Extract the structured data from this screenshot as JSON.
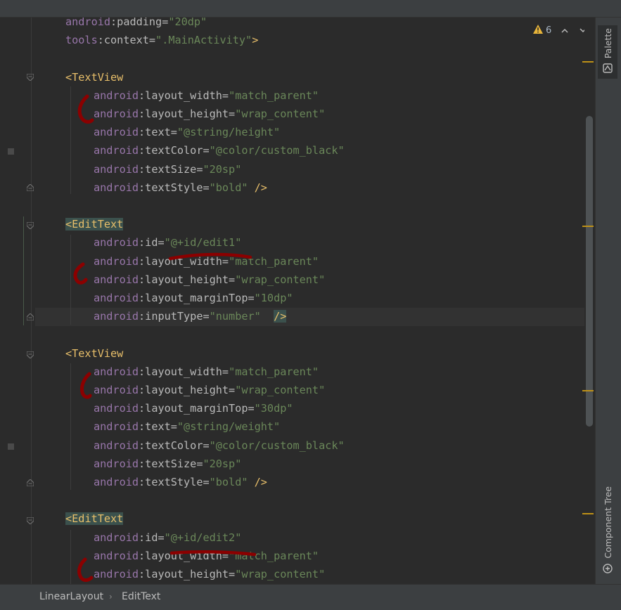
{
  "editor": {
    "lines": [
      {
        "indent": 0,
        "type": "attr",
        "ns": "android",
        "name": "padding",
        "value": "\"20dp\""
      },
      {
        "indent": 0,
        "type": "attr_close",
        "ns": "tools",
        "name": "context",
        "value": "\".MainActivity\"",
        "close": ">"
      },
      {
        "indent": 0,
        "type": "blank"
      },
      {
        "indent": 0,
        "type": "tag",
        "text": "<TextView"
      },
      {
        "indent": 1,
        "type": "attr",
        "ns": "android",
        "name": "layout_width",
        "value": "\"match_parent\""
      },
      {
        "indent": 1,
        "type": "attr",
        "ns": "android",
        "name": "layout_height",
        "value": "\"wrap_content\""
      },
      {
        "indent": 1,
        "type": "attr",
        "ns": "android",
        "name": "text",
        "value": "\"@string/height\""
      },
      {
        "indent": 1,
        "type": "attr",
        "ns": "android",
        "name": "textColor",
        "value": "\"@color/custom_black\""
      },
      {
        "indent": 1,
        "type": "attr",
        "ns": "android",
        "name": "textSize",
        "value": "\"20sp\""
      },
      {
        "indent": 1,
        "type": "attr_close",
        "ns": "android",
        "name": "textStyle",
        "value": "\"bold\"",
        "close": " />"
      },
      {
        "indent": 0,
        "type": "blank"
      },
      {
        "indent": 0,
        "type": "tag_hl",
        "lt": "<",
        "text": "EditText"
      },
      {
        "indent": 1,
        "type": "attr",
        "ns": "android",
        "name": "id",
        "value": "\"@+id/edit1\""
      },
      {
        "indent": 1,
        "type": "attr",
        "ns": "android",
        "name": "layout_width",
        "value": "\"match_parent\""
      },
      {
        "indent": 1,
        "type": "attr",
        "ns": "android",
        "name": "layout_height",
        "value": "\"wrap_content\""
      },
      {
        "indent": 1,
        "type": "attr",
        "ns": "android",
        "name": "layout_marginTop",
        "value": "\"10dp\""
      },
      {
        "indent": 1,
        "type": "attr_close_hl",
        "ns": "android",
        "name": "inputType",
        "value": "\"number\"",
        "close": "/>"
      },
      {
        "indent": 0,
        "type": "blank"
      },
      {
        "indent": 0,
        "type": "tag",
        "text": "<TextView"
      },
      {
        "indent": 1,
        "type": "attr",
        "ns": "android",
        "name": "layout_width",
        "value": "\"match_parent\""
      },
      {
        "indent": 1,
        "type": "attr",
        "ns": "android",
        "name": "layout_height",
        "value": "\"wrap_content\""
      },
      {
        "indent": 1,
        "type": "attr",
        "ns": "android",
        "name": "layout_marginTop",
        "value": "\"30dp\""
      },
      {
        "indent": 1,
        "type": "attr",
        "ns": "android",
        "name": "text",
        "value": "\"@string/weight\""
      },
      {
        "indent": 1,
        "type": "attr",
        "ns": "android",
        "name": "textColor",
        "value": "\"@color/custom_black\""
      },
      {
        "indent": 1,
        "type": "attr",
        "ns": "android",
        "name": "textSize",
        "value": "\"20sp\""
      },
      {
        "indent": 1,
        "type": "attr_close",
        "ns": "android",
        "name": "textStyle",
        "value": "\"bold\"",
        "close": " />"
      },
      {
        "indent": 0,
        "type": "blank"
      },
      {
        "indent": 0,
        "type": "tag_hl",
        "lt": "<",
        "text": "EditText"
      },
      {
        "indent": 1,
        "type": "attr",
        "ns": "android",
        "name": "id",
        "value": "\"@+id/edit2\""
      },
      {
        "indent": 1,
        "type": "attr",
        "ns": "android",
        "name": "layout_width",
        "value": "\"match_parent\""
      },
      {
        "indent": 1,
        "type": "attr",
        "ns": "android",
        "name": "layout_height",
        "value": "\"wrap_content\""
      }
    ]
  },
  "inspection": {
    "warning_count": "6"
  },
  "right_panel": {
    "palette": "Palette",
    "component_tree": "Component Tree"
  },
  "breadcrumb": [
    "LinearLayout",
    "EditText"
  ],
  "colors": {
    "namespace": "#9876aa",
    "attribute": "#bababa",
    "value": "#6a8759",
    "tag": "#e8bf6a",
    "annotation": "#8b0000",
    "warning": "#e8b53a"
  }
}
